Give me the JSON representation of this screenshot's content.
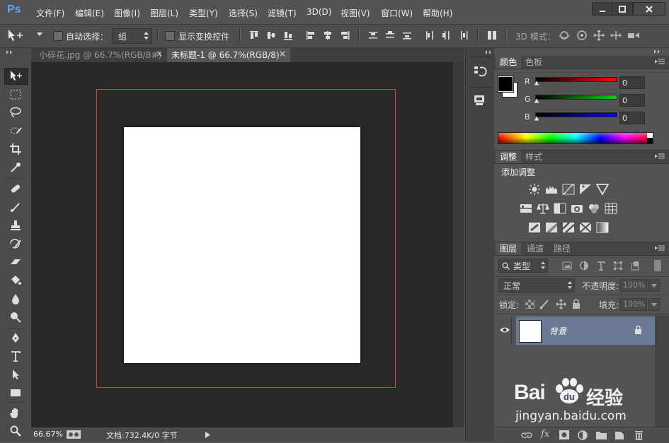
{
  "app": {
    "logo": "Ps"
  },
  "menu": [
    "文件(F)",
    "编辑(E)",
    "图像(I)",
    "图层(L)",
    "类型(Y)",
    "选择(S)",
    "滤镜(T)",
    "3D(D)",
    "视图(V)",
    "窗口(W)",
    "帮助(H)"
  ],
  "options": {
    "auto_select_label": "自动选择：",
    "auto_select_value": "组",
    "show_transform_label": "显示变换控件",
    "mode3d_label": "3D 模式："
  },
  "tabs": [
    {
      "label": "小碎花.jpg @ 66.7%(RGB/8#)",
      "close": "×",
      "active": false
    },
    {
      "label": "未标题-1 @ 66.7%(RGB/8)",
      "close": "×",
      "active": true
    }
  ],
  "status": {
    "zoom": "66.67%",
    "doc": "文档:732.4K/0 字节"
  },
  "color_panel": {
    "tabs": [
      "颜色",
      "色板"
    ],
    "channels": [
      {
        "label": "R",
        "value": "0",
        "color": "#ff0000"
      },
      {
        "label": "G",
        "value": "0",
        "color": "#00d400"
      },
      {
        "label": "B",
        "value": "0",
        "color": "#0000ff"
      }
    ]
  },
  "adjust_panel": {
    "tabs": [
      "调整",
      "样式"
    ],
    "title": "添加调整"
  },
  "layers_panel": {
    "tabs": [
      "图层",
      "通道",
      "路径"
    ],
    "filter_label": "类型",
    "blend_mode": "正常",
    "opacity_label": "不透明度:",
    "opacity_value": "100%",
    "lock_label": "锁定:",
    "fill_label": "填充:",
    "fill_value": "100%",
    "layer_name": "背景"
  },
  "watermark": {
    "brand": "Bai",
    "brand2": "经验",
    "url": "jingyan.baidu.com"
  },
  "colors": {
    "canvas_bg": "#282828",
    "guide_red": "#e23a3a",
    "accent_layer": "#6a7a94"
  }
}
